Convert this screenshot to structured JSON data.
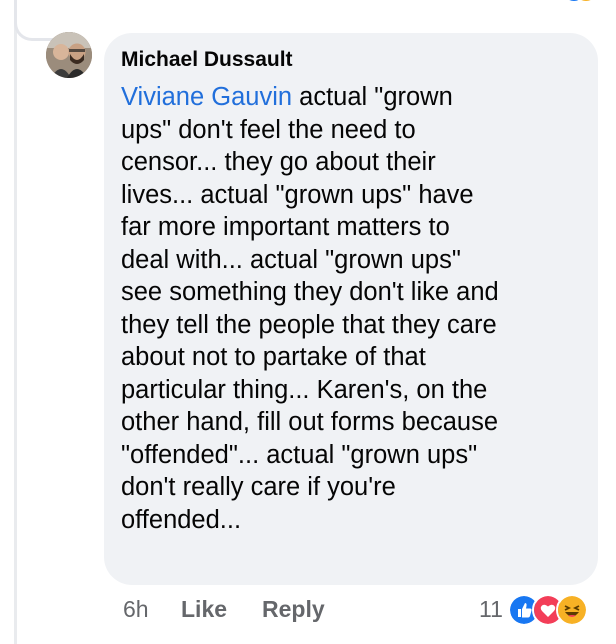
{
  "comment": {
    "author": "Michael Dussault",
    "mention": "Viviane Gauvin",
    "lines": [
      " actual \"grown",
      "ups\" don't feel the need to",
      "censor... they go about their",
      "lives... actual \"grown ups\" have",
      "far more important matters to",
      "deal with... actual \"grown ups\"",
      "see something they don't like and",
      "they tell the people that they care",
      "about not to partake of that",
      "particular thing... Karen's, on the",
      "other hand, fill out forms because",
      "\"offended\"... actual \"grown ups\"",
      "don't really care if you're",
      "offended..."
    ],
    "timestamp": "6h",
    "like_label": "Like",
    "reply_label": "Reply",
    "reaction_count": "11",
    "reactions": [
      "like-icon",
      "love-icon",
      "haha-icon"
    ]
  },
  "colors": {
    "mention": "#216fdb",
    "bubble": "#f0f2f5",
    "meta_text": "#65676b",
    "like": "#1877f2",
    "love": "#f33e58",
    "haha": "#f7b125"
  }
}
